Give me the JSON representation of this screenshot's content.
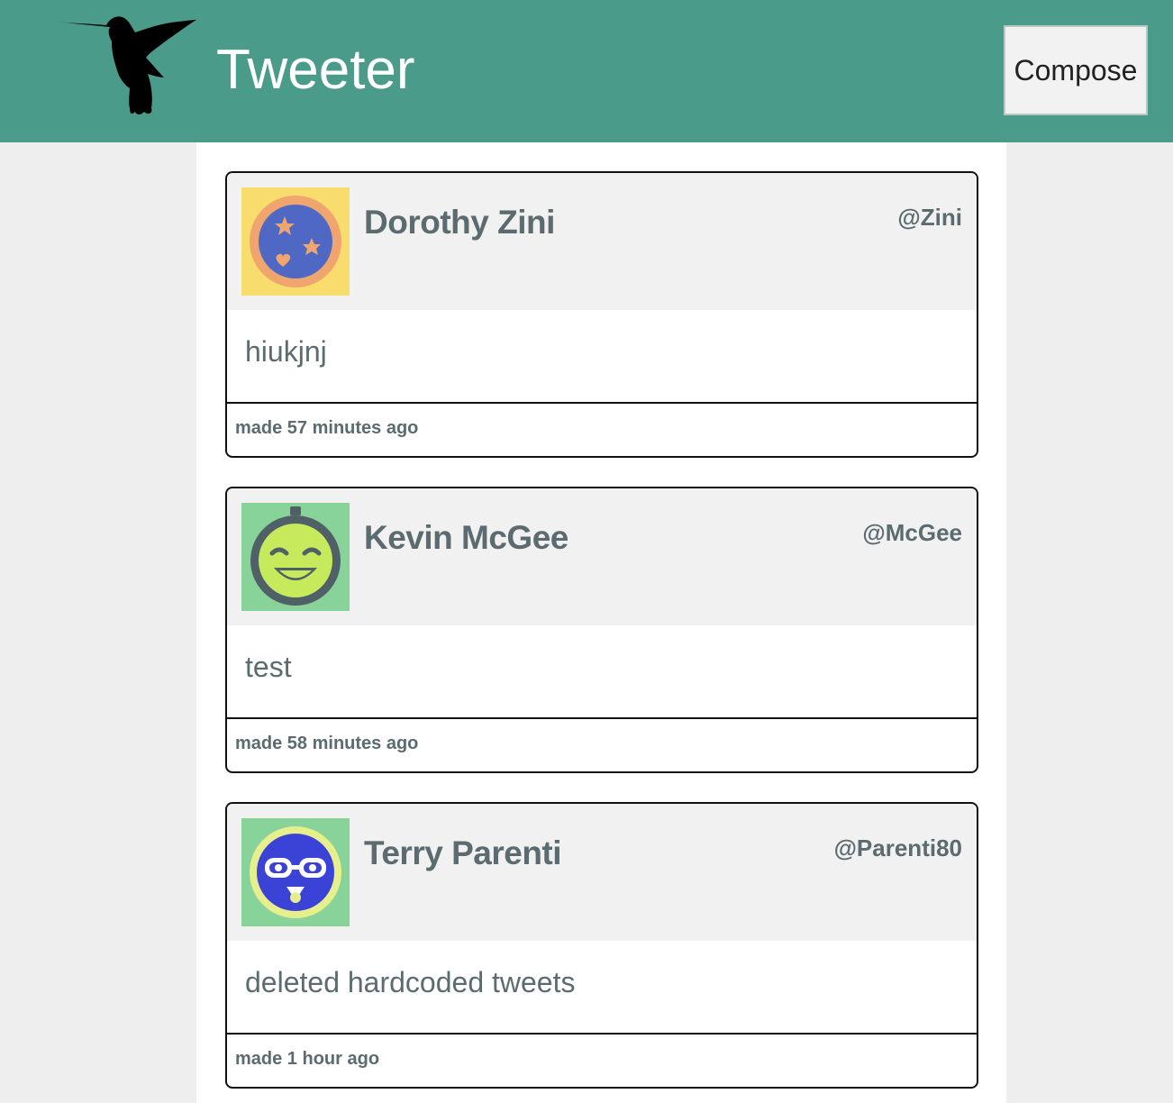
{
  "nav": {
    "brand": "Tweeter",
    "compose_label": "Compose",
    "color": "#4a9b89"
  },
  "tweets": [
    {
      "name": "Dorothy Zini",
      "handle": "@Zini",
      "content": "hiukjnj",
      "timestamp": "made 57 minutes ago",
      "avatar": {
        "icon": "stars-heart-avatar-icon",
        "bg": "#f8dc6d"
      }
    },
    {
      "name": "Kevin McGee",
      "handle": "@McGee",
      "content": "test",
      "timestamp": "made 58 minutes ago",
      "avatar": {
        "icon": "smiling-face-avatar-icon",
        "bg": "#88d39a"
      }
    },
    {
      "name": "Terry Parenti",
      "handle": "@Parenti80",
      "content": "deleted hardcoded tweets",
      "timestamp": "made 1 hour ago",
      "avatar": {
        "icon": "glasses-face-avatar-icon",
        "bg": "#88d39a"
      }
    }
  ]
}
